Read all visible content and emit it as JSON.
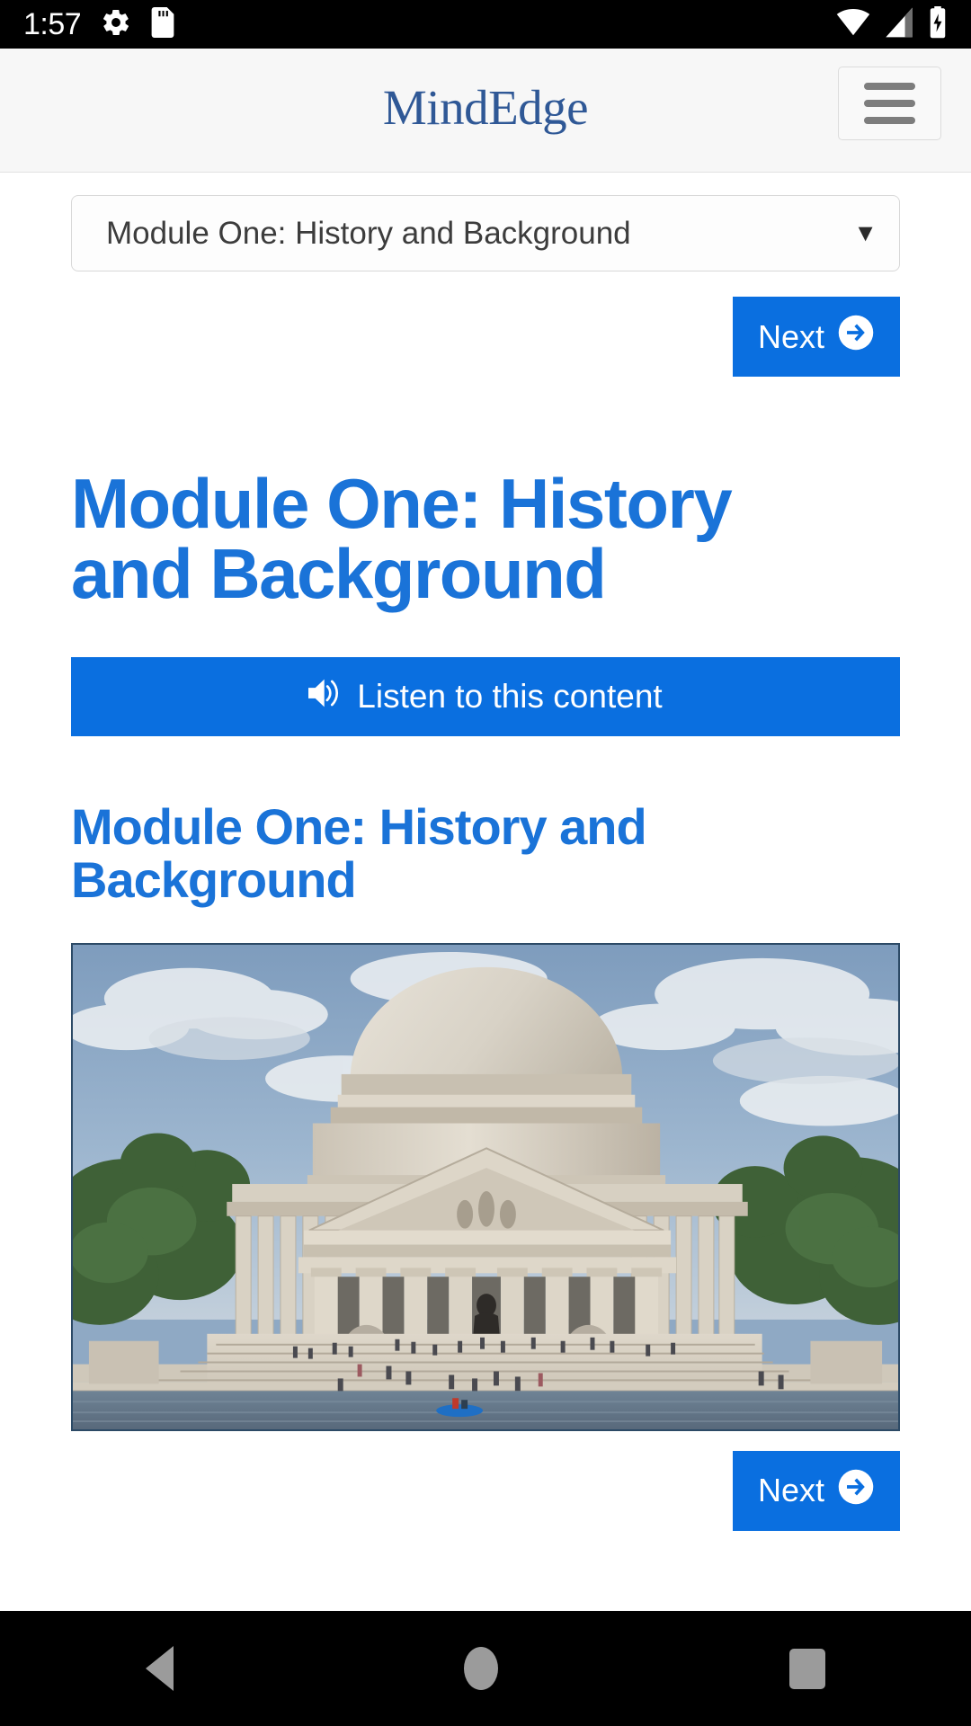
{
  "status_bar": {
    "time": "1:57",
    "left_icons": [
      "settings-gear-icon",
      "sd-card-icon"
    ],
    "right_icons": [
      "wifi-icon",
      "cellular-signal-icon",
      "battery-charging-icon"
    ]
  },
  "header": {
    "brand": "MindEdge",
    "menu_icon": "hamburger-menu-icon"
  },
  "module_select": {
    "value": "Module One: History and Background",
    "caret": "▼"
  },
  "buttons": {
    "next_label": "Next",
    "next_icon": "arrow-circle-right-icon",
    "listen_label": "Listen to this content",
    "listen_icon": "volume-up-icon"
  },
  "main": {
    "page_title": "Module One: History and Background",
    "section_title": "Module One: History and Background",
    "image_alt": "Jefferson Memorial"
  },
  "nav_bar": {
    "back": "back-button",
    "home": "home-button",
    "recents": "recents-button"
  },
  "colors": {
    "accent_blue": "#0a6fe0",
    "heading_blue": "#1a73d8",
    "brand_blue": "#2f5896",
    "header_bg": "#f7f7f7",
    "nav_icon_gray": "#9b9b9b"
  }
}
